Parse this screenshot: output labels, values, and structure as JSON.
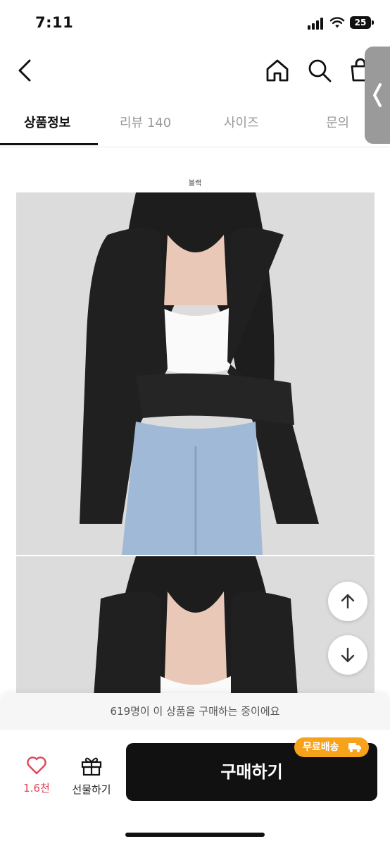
{
  "status_bar": {
    "time": "7:11",
    "battery": "25"
  },
  "tabs": [
    {
      "label": "상품정보",
      "active": true
    },
    {
      "label": "리뷰 140",
      "active": false
    },
    {
      "label": "사이즈",
      "active": false
    },
    {
      "label": "문의",
      "active": false
    }
  ],
  "product": {
    "color_label": "블랙"
  },
  "bottom": {
    "notice": "619명이 이 상품을 구매하는 중이에요",
    "like_count": "1.6천",
    "gift_label": "선물하기",
    "buy_label": "구매하기",
    "badge_label": "무료배송"
  },
  "colors": {
    "accent": "#f7a21b",
    "like": "#e0455a",
    "primary": "#111111"
  }
}
